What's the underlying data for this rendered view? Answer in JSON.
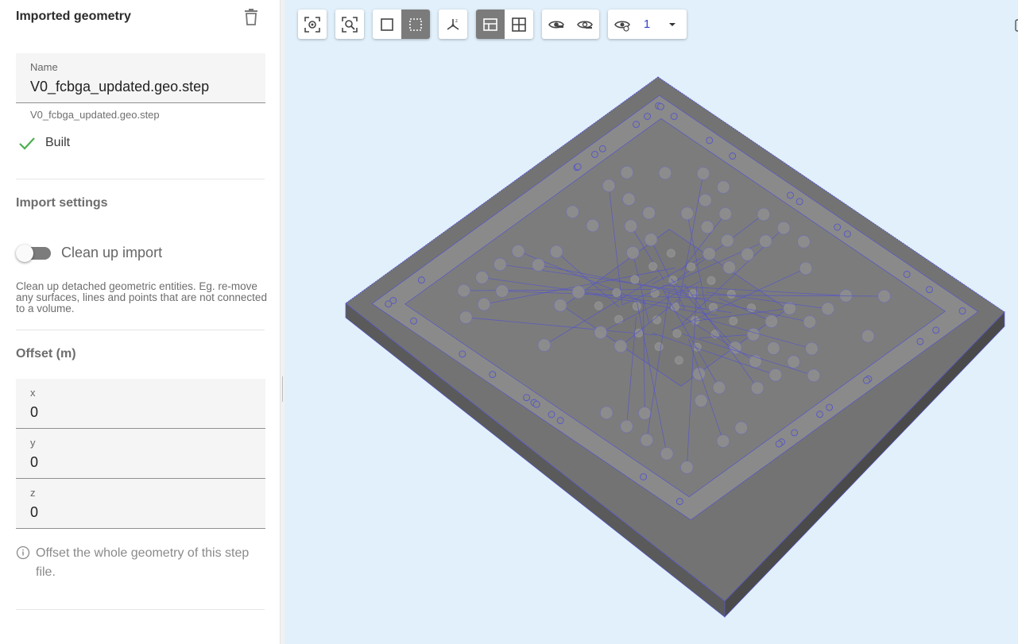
{
  "panel": {
    "title": "Imported geometry",
    "name_field": {
      "label": "Name",
      "value": "V0_fcbga_updated.geo.step"
    },
    "filename": "V0_fcbga_updated.geo.step",
    "status": "Built",
    "import_settings_title": "Import settings",
    "cleanup_toggle": {
      "label": "Clean up import",
      "on": false
    },
    "cleanup_description": "Clean up detached geometric entities. Eg. re-move any surfaces, lines and points that are not connected to a volume.",
    "offset_title": "Offset (m)",
    "offset": [
      {
        "label": "x",
        "value": "0"
      },
      {
        "label": "y",
        "value": "0"
      },
      {
        "label": "z",
        "value": "0"
      }
    ],
    "offset_info": "Offset the whole geometry of this step file."
  },
  "toolbar": {
    "groups": [
      [
        "focus-icon"
      ],
      [
        "zoom-fit-icon"
      ],
      [
        "solid-mode-icon",
        "dashed-selection-icon"
      ],
      [
        "axes-icon"
      ],
      [
        "section-view-icon",
        "grid-view-icon"
      ],
      [
        "hide-icon",
        "hide-others-icon"
      ],
      [
        "visibility-layer-icon"
      ]
    ],
    "layer_value": "1"
  },
  "colors": {
    "viewport_bg": "#e1f0fb",
    "model_fill": "#6f6f6f",
    "model_edges": "#5555cc",
    "success": "#4caf50",
    "active_button": "#7b7b7b"
  }
}
